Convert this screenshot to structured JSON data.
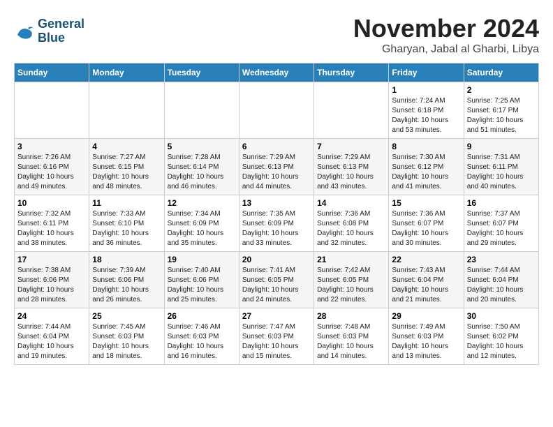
{
  "header": {
    "logo_line1": "General",
    "logo_line2": "Blue",
    "month_title": "November 2024",
    "subtitle": "Gharyan, Jabal al Gharbi, Libya"
  },
  "weekdays": [
    "Sunday",
    "Monday",
    "Tuesday",
    "Wednesday",
    "Thursday",
    "Friday",
    "Saturday"
  ],
  "weeks": [
    [
      {
        "day": "",
        "info": ""
      },
      {
        "day": "",
        "info": ""
      },
      {
        "day": "",
        "info": ""
      },
      {
        "day": "",
        "info": ""
      },
      {
        "day": "",
        "info": ""
      },
      {
        "day": "1",
        "info": "Sunrise: 7:24 AM\nSunset: 6:18 PM\nDaylight: 10 hours and 53 minutes."
      },
      {
        "day": "2",
        "info": "Sunrise: 7:25 AM\nSunset: 6:17 PM\nDaylight: 10 hours and 51 minutes."
      }
    ],
    [
      {
        "day": "3",
        "info": "Sunrise: 7:26 AM\nSunset: 6:16 PM\nDaylight: 10 hours and 49 minutes."
      },
      {
        "day": "4",
        "info": "Sunrise: 7:27 AM\nSunset: 6:15 PM\nDaylight: 10 hours and 48 minutes."
      },
      {
        "day": "5",
        "info": "Sunrise: 7:28 AM\nSunset: 6:14 PM\nDaylight: 10 hours and 46 minutes."
      },
      {
        "day": "6",
        "info": "Sunrise: 7:29 AM\nSunset: 6:13 PM\nDaylight: 10 hours and 44 minutes."
      },
      {
        "day": "7",
        "info": "Sunrise: 7:29 AM\nSunset: 6:13 PM\nDaylight: 10 hours and 43 minutes."
      },
      {
        "day": "8",
        "info": "Sunrise: 7:30 AM\nSunset: 6:12 PM\nDaylight: 10 hours and 41 minutes."
      },
      {
        "day": "9",
        "info": "Sunrise: 7:31 AM\nSunset: 6:11 PM\nDaylight: 10 hours and 40 minutes."
      }
    ],
    [
      {
        "day": "10",
        "info": "Sunrise: 7:32 AM\nSunset: 6:11 PM\nDaylight: 10 hours and 38 minutes."
      },
      {
        "day": "11",
        "info": "Sunrise: 7:33 AM\nSunset: 6:10 PM\nDaylight: 10 hours and 36 minutes."
      },
      {
        "day": "12",
        "info": "Sunrise: 7:34 AM\nSunset: 6:09 PM\nDaylight: 10 hours and 35 minutes."
      },
      {
        "day": "13",
        "info": "Sunrise: 7:35 AM\nSunset: 6:09 PM\nDaylight: 10 hours and 33 minutes."
      },
      {
        "day": "14",
        "info": "Sunrise: 7:36 AM\nSunset: 6:08 PM\nDaylight: 10 hours and 32 minutes."
      },
      {
        "day": "15",
        "info": "Sunrise: 7:36 AM\nSunset: 6:07 PM\nDaylight: 10 hours and 30 minutes."
      },
      {
        "day": "16",
        "info": "Sunrise: 7:37 AM\nSunset: 6:07 PM\nDaylight: 10 hours and 29 minutes."
      }
    ],
    [
      {
        "day": "17",
        "info": "Sunrise: 7:38 AM\nSunset: 6:06 PM\nDaylight: 10 hours and 28 minutes."
      },
      {
        "day": "18",
        "info": "Sunrise: 7:39 AM\nSunset: 6:06 PM\nDaylight: 10 hours and 26 minutes."
      },
      {
        "day": "19",
        "info": "Sunrise: 7:40 AM\nSunset: 6:06 PM\nDaylight: 10 hours and 25 minutes."
      },
      {
        "day": "20",
        "info": "Sunrise: 7:41 AM\nSunset: 6:05 PM\nDaylight: 10 hours and 24 minutes."
      },
      {
        "day": "21",
        "info": "Sunrise: 7:42 AM\nSunset: 6:05 PM\nDaylight: 10 hours and 22 minutes."
      },
      {
        "day": "22",
        "info": "Sunrise: 7:43 AM\nSunset: 6:04 PM\nDaylight: 10 hours and 21 minutes."
      },
      {
        "day": "23",
        "info": "Sunrise: 7:44 AM\nSunset: 6:04 PM\nDaylight: 10 hours and 20 minutes."
      }
    ],
    [
      {
        "day": "24",
        "info": "Sunrise: 7:44 AM\nSunset: 6:04 PM\nDaylight: 10 hours and 19 minutes."
      },
      {
        "day": "25",
        "info": "Sunrise: 7:45 AM\nSunset: 6:03 PM\nDaylight: 10 hours and 18 minutes."
      },
      {
        "day": "26",
        "info": "Sunrise: 7:46 AM\nSunset: 6:03 PM\nDaylight: 10 hours and 16 minutes."
      },
      {
        "day": "27",
        "info": "Sunrise: 7:47 AM\nSunset: 6:03 PM\nDaylight: 10 hours and 15 minutes."
      },
      {
        "day": "28",
        "info": "Sunrise: 7:48 AM\nSunset: 6:03 PM\nDaylight: 10 hours and 14 minutes."
      },
      {
        "day": "29",
        "info": "Sunrise: 7:49 AM\nSunset: 6:03 PM\nDaylight: 10 hours and 13 minutes."
      },
      {
        "day": "30",
        "info": "Sunrise: 7:50 AM\nSunset: 6:02 PM\nDaylight: 10 hours and 12 minutes."
      }
    ]
  ]
}
